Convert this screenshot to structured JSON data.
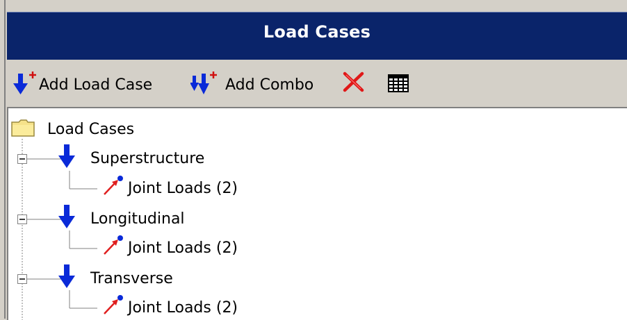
{
  "panel": {
    "title": "Load Cases",
    "toolbar": {
      "add_load_case_label": "Add Load Case",
      "add_combo_label": "Add Combo",
      "icons": [
        "add-load-case-icon",
        "add-combo-icon",
        "delete-icon",
        "table-icon"
      ]
    },
    "tree": {
      "root_label": "Load Cases",
      "cases": [
        {
          "label": "Superstructure",
          "child": "Joint Loads (2)",
          "expanded": true
        },
        {
          "label": "Longitudinal",
          "child": "Joint Loads (2)",
          "expanded": true
        },
        {
          "label": "Transverse",
          "child": "Joint Loads (2)",
          "expanded": true
        }
      ]
    },
    "colors": {
      "title_bar": "#0a246a",
      "arrow_blue": "#0a2ad8",
      "joint_load_red": "#e02020",
      "delete_red": "#e01818",
      "panel_gray": "#d4d0c8"
    }
  }
}
